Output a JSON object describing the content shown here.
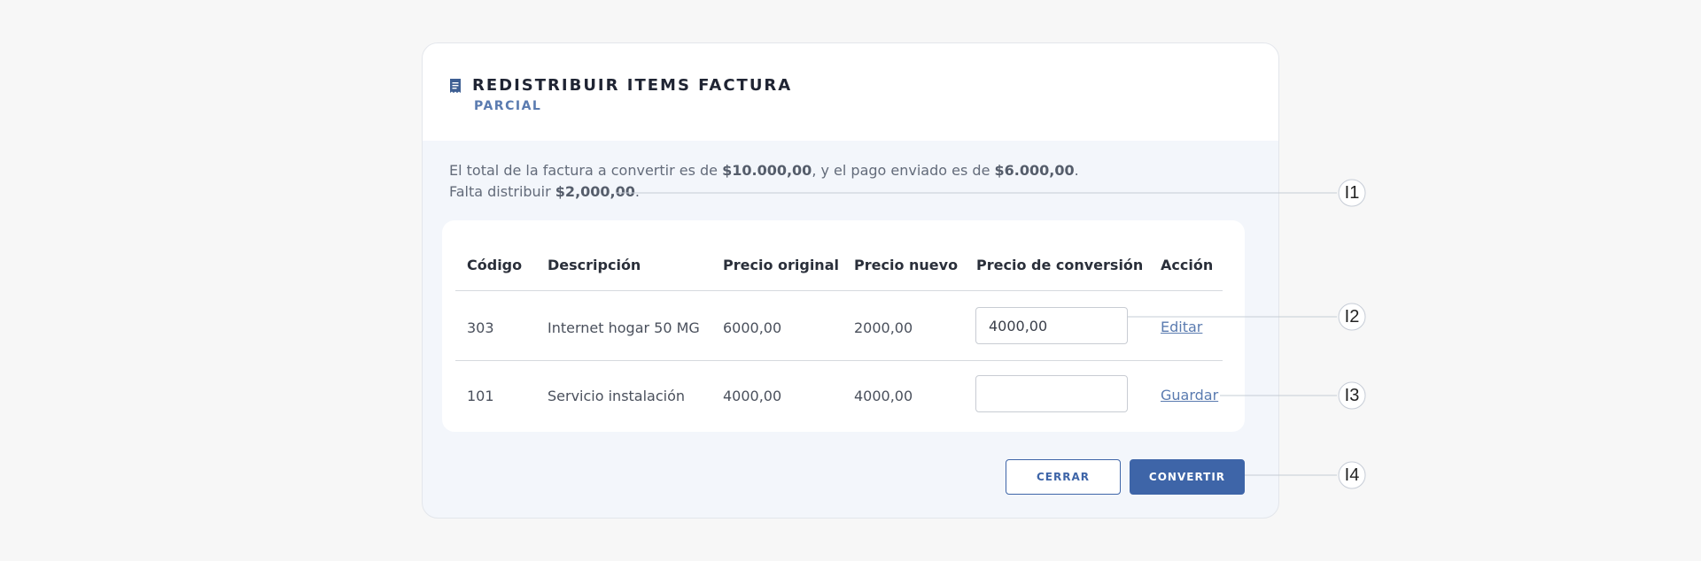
{
  "dialog": {
    "title": "REDISTRIBUIR ITEMS FACTURA",
    "subtitle": "PARCIAL",
    "summary": {
      "line1_prefix": "El total de la factura a convertir es de ",
      "total": "$10.000,00",
      "line1_middle": ", y el pago enviado es de ",
      "payment": "$6.000,00",
      "line1_end": ".",
      "line2_prefix": "Falta distribuir ",
      "remaining": "$2,000,00",
      "line2_end": "."
    },
    "table": {
      "headers": [
        "Código",
        "Descripción",
        "Precio original",
        "Precio nuevo",
        "Precio de conversión",
        "Acción"
      ],
      "rows": [
        {
          "code": "303",
          "description": "Internet hogar 50 MG",
          "original_price": "6000,00",
          "new_price": "2000,00",
          "conversion_price": "4000,00",
          "action": "Editar"
        },
        {
          "code": "101",
          "description": "Servicio instalación",
          "original_price": "4000,00",
          "new_price": "4000,00",
          "conversion_price": "",
          "action": "Guardar"
        }
      ]
    },
    "buttons": {
      "close": "CERRAR",
      "convert": "CONVERTIR"
    }
  },
  "callouts": [
    "I1",
    "I2",
    "I3",
    "I4"
  ],
  "colors": {
    "accent": "#3e65a8",
    "subtitle": "#5a7bb0",
    "card_body": "#f3f6fb"
  },
  "icons": {
    "header": "receipt-icon"
  }
}
